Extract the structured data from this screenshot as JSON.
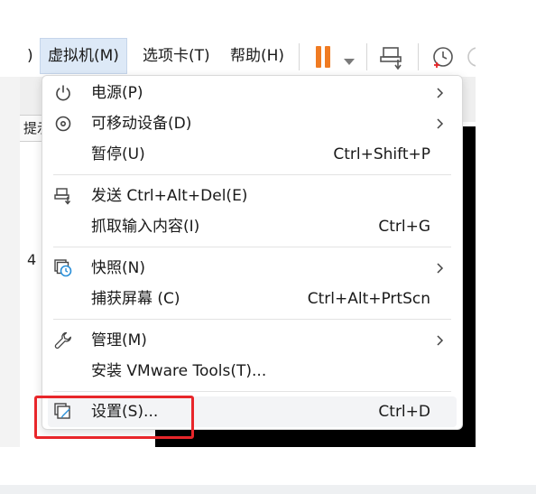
{
  "menubar": {
    "prev_paren": ")",
    "vm_menu": "虚拟机(M)",
    "tabs_menu": "选项卡(T)",
    "help_menu": "帮助(H)"
  },
  "background": {
    "field_text": "提示",
    "digit": "4"
  },
  "vm_menu": {
    "items": [
      {
        "label": "电源(P)",
        "accel": "",
        "submenu": true,
        "icon": "power-icon"
      },
      {
        "label": "可移动设备(D)",
        "accel": "",
        "submenu": true,
        "icon": "disc-icon"
      },
      {
        "label": "暂停(U)",
        "accel": "Ctrl+Shift+P",
        "submenu": false,
        "icon": ""
      },
      {
        "label": "发送 Ctrl+Alt+Del(E)",
        "accel": "",
        "submenu": false,
        "icon": "send-keys-icon"
      },
      {
        "label": "抓取输入内容(I)",
        "accel": "Ctrl+G",
        "submenu": false,
        "icon": ""
      },
      {
        "label": "快照(N)",
        "accel": "",
        "submenu": true,
        "icon": "snapshot-icon"
      },
      {
        "label": "捕获屏幕 (C)",
        "accel": "Ctrl+Alt+PrtScn",
        "submenu": false,
        "icon": ""
      },
      {
        "label": "管理(M)",
        "accel": "",
        "submenu": true,
        "icon": "wrench-icon"
      },
      {
        "label": "安装 VMware Tools(T)...",
        "accel": "",
        "submenu": false,
        "icon": ""
      },
      {
        "label": "设置(S)...",
        "accel": "Ctrl+D",
        "submenu": false,
        "icon": "settings-icon"
      }
    ]
  },
  "colors": {
    "pause_orange": "#f07b22",
    "highlight_red": "#e8262a",
    "active_menu_bg": "#dde9f7",
    "snapshot_blue": "#2a8fd8"
  }
}
